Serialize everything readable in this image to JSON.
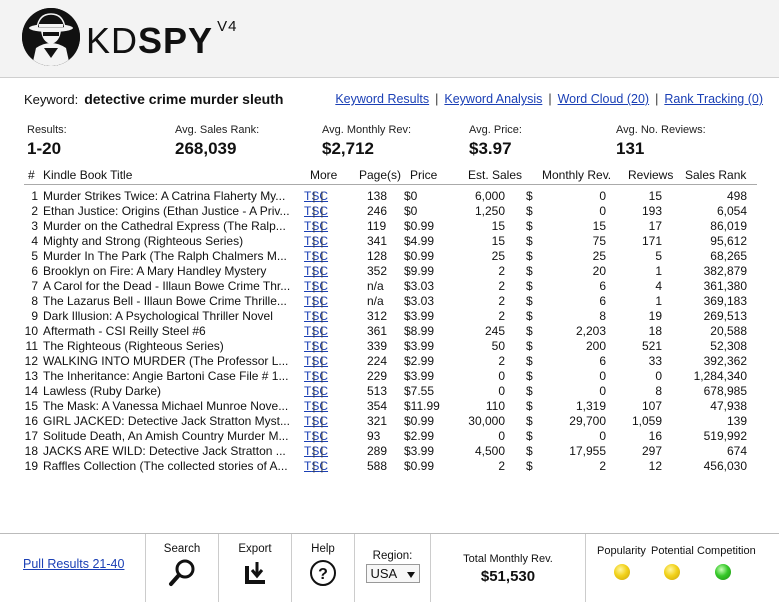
{
  "brand": {
    "name_light": "KD",
    "name_bold": "SPY",
    "version": "V4"
  },
  "keyword": {
    "label": "Keyword:",
    "value": "detective crime murder sleuth"
  },
  "top_links": [
    {
      "label": "Keyword Results"
    },
    {
      "label": "Keyword Analysis"
    },
    {
      "label": "Word Cloud (20)"
    },
    {
      "label": "Rank Tracking (0)"
    }
  ],
  "separator": "|",
  "stats": {
    "results": {
      "label": "Results:",
      "value": "1-20"
    },
    "avg_sales_rank": {
      "label": "Avg. Sales Rank:",
      "value": "268,039"
    },
    "avg_monthly_rev": {
      "label": "Avg. Monthly Rev:",
      "value": "$2,712"
    },
    "avg_price": {
      "label": "Avg. Price:",
      "value": "$3.97"
    },
    "avg_reviews": {
      "label": "Avg. No. Reviews:",
      "value": "131"
    }
  },
  "columns": {
    "num": "#",
    "title": "Kindle Book Title",
    "more": "More",
    "pages": "Page(s)",
    "price": "Price",
    "sales": "Est. Sales",
    "rev": "Monthly Rev.",
    "reviews": "Reviews",
    "rank": "Sales Rank"
  },
  "more_links": {
    "t": "T",
    "s": "S",
    "c": "C"
  },
  "currency": "$",
  "rows": [
    {
      "num": "1",
      "title": "Murder Strikes Twice: A Catrina Flaherty My...",
      "pages": "138",
      "price": "$0",
      "sales": "6,000",
      "rev": "0",
      "reviews": "15",
      "rank": "498"
    },
    {
      "num": "2",
      "title": "Ethan Justice: Origins (Ethan Justice - A Priv...",
      "pages": "246",
      "price": "$0",
      "sales": "1,250",
      "rev": "0",
      "reviews": "193",
      "rank": "6,054"
    },
    {
      "num": "3",
      "title": "Murder on the Cathedral Express (The Ralp...",
      "pages": "119",
      "price": "$0.99",
      "sales": "15",
      "rev": "15",
      "reviews": "17",
      "rank": "86,019"
    },
    {
      "num": "4",
      "title": "Mighty and Strong (Righteous Series)",
      "pages": "341",
      "price": "$4.99",
      "sales": "15",
      "rev": "75",
      "reviews": "171",
      "rank": "95,612"
    },
    {
      "num": "5",
      "title": "Murder In The Park (The Ralph Chalmers M...",
      "pages": "128",
      "price": "$0.99",
      "sales": "25",
      "rev": "25",
      "reviews": "5",
      "rank": "68,265"
    },
    {
      "num": "6",
      "title": "Brooklyn on Fire: A Mary Handley Mystery",
      "pages": "352",
      "price": "$9.99",
      "sales": "2",
      "rev": "20",
      "reviews": "1",
      "rank": "382,879"
    },
    {
      "num": "7",
      "title": "A Carol for the Dead - Illaun Bowe Crime Thr...",
      "pages": "n/a",
      "price": "$3.03",
      "sales": "2",
      "rev": "6",
      "reviews": "4",
      "rank": "361,380"
    },
    {
      "num": "8",
      "title": "The Lazarus Bell - Illaun Bowe Crime Thrille...",
      "pages": "n/a",
      "price": "$3.03",
      "sales": "2",
      "rev": "6",
      "reviews": "1",
      "rank": "369,183"
    },
    {
      "num": "9",
      "title": "Dark Illusion: A Psychological Thriller Novel",
      "pages": "312",
      "price": "$3.99",
      "sales": "2",
      "rev": "8",
      "reviews": "19",
      "rank": "269,513"
    },
    {
      "num": "10",
      "title": "Aftermath - CSI Reilly Steel #6",
      "pages": "361",
      "price": "$8.99",
      "sales": "245",
      "rev": "2,203",
      "reviews": "18",
      "rank": "20,588"
    },
    {
      "num": "11",
      "title": "The Righteous (Righteous Series)",
      "pages": "339",
      "price": "$3.99",
      "sales": "50",
      "rev": "200",
      "reviews": "521",
      "rank": "52,308"
    },
    {
      "num": "12",
      "title": "WALKING INTO MURDER (The Professor L...",
      "pages": "224",
      "price": "$2.99",
      "sales": "2",
      "rev": "6",
      "reviews": "33",
      "rank": "392,362"
    },
    {
      "num": "13",
      "title": "The Inheritance: Angie Bartoni Case File # 1...",
      "pages": "229",
      "price": "$3.99",
      "sales": "0",
      "rev": "0",
      "reviews": "0",
      "rank": "1,284,340"
    },
    {
      "num": "14",
      "title": "Lawless (Ruby Darke)",
      "pages": "513",
      "price": "$7.55",
      "sales": "0",
      "rev": "0",
      "reviews": "8",
      "rank": "678,985"
    },
    {
      "num": "15",
      "title": "The Mask: A Vanessa Michael Munroe Nove...",
      "pages": "354",
      "price": "$11.99",
      "sales": "110",
      "rev": "1,319",
      "reviews": "107",
      "rank": "47,938"
    },
    {
      "num": "16",
      "title": "GIRL JACKED: Detective Jack Stratton Myst...",
      "pages": "321",
      "price": "$0.99",
      "sales": "30,000",
      "rev": "29,700",
      "reviews": "1,059",
      "rank": "139"
    },
    {
      "num": "17",
      "title": "Solitude Death, An Amish Country Murder M...",
      "pages": "93",
      "price": "$2.99",
      "sales": "0",
      "rev": "0",
      "reviews": "16",
      "rank": "519,992"
    },
    {
      "num": "18",
      "title": "JACKS ARE WILD: Detective Jack Stratton ...",
      "pages": "289",
      "price": "$3.99",
      "sales": "4,500",
      "rev": "17,955",
      "reviews": "297",
      "rank": "674"
    },
    {
      "num": "19",
      "title": "Raffles Collection (The collected stories of A...",
      "pages": "588",
      "price": "$0.99",
      "sales": "2",
      "rev": "2",
      "reviews": "12",
      "rank": "456,030"
    }
  ],
  "footer": {
    "pull": "Pull Results 21-40",
    "search": "Search",
    "export": "Export",
    "help": "Help",
    "region_label": "Region:",
    "region_value": "USA",
    "total_label": "Total Monthly Rev.",
    "total_value": "$51,530",
    "popularity": "Popularity",
    "potential": "Potential",
    "competition": "Competition"
  },
  "colors": {
    "link": "#1a3fb5",
    "yellow": "#f2d21b",
    "green": "#37c92a"
  },
  "icons": [
    "spy-logo-icon",
    "search-icon",
    "export-icon",
    "help-icon",
    "chevron-down-icon"
  ]
}
